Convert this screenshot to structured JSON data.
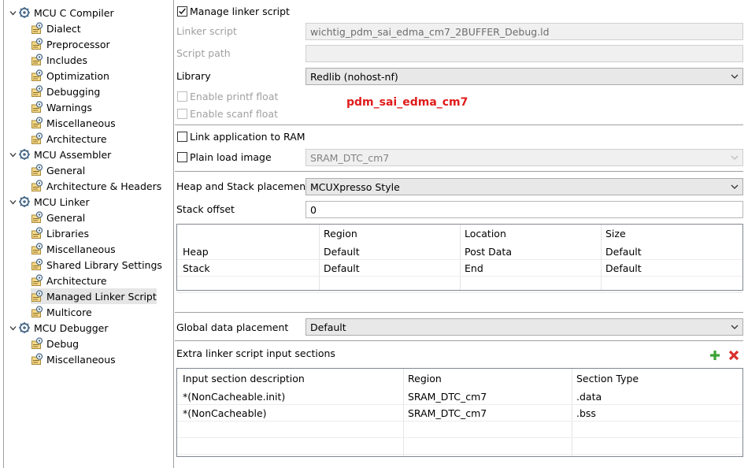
{
  "tree": [
    {
      "label": "MCU C Compiler",
      "level": 0,
      "icon": "settings-gear-icon"
    },
    {
      "label": "Dialect",
      "level": 1,
      "icon": "settings-page-icon"
    },
    {
      "label": "Preprocessor",
      "level": 1,
      "icon": "settings-page-icon"
    },
    {
      "label": "Includes",
      "level": 1,
      "icon": "settings-page-icon"
    },
    {
      "label": "Optimization",
      "level": 1,
      "icon": "settings-page-icon"
    },
    {
      "label": "Debugging",
      "level": 1,
      "icon": "settings-page-icon"
    },
    {
      "label": "Warnings",
      "level": 1,
      "icon": "settings-page-icon"
    },
    {
      "label": "Miscellaneous",
      "level": 1,
      "icon": "settings-page-icon"
    },
    {
      "label": "Architecture",
      "level": 1,
      "icon": "settings-page-icon"
    },
    {
      "label": "MCU Assembler",
      "level": 0,
      "icon": "settings-gear-icon"
    },
    {
      "label": "General",
      "level": 1,
      "icon": "settings-page-icon"
    },
    {
      "label": "Architecture & Headers",
      "level": 1,
      "icon": "settings-page-icon"
    },
    {
      "label": "MCU Linker",
      "level": 0,
      "icon": "settings-gear-icon"
    },
    {
      "label": "General",
      "level": 1,
      "icon": "settings-page-icon"
    },
    {
      "label": "Libraries",
      "level": 1,
      "icon": "settings-page-icon"
    },
    {
      "label": "Miscellaneous",
      "level": 1,
      "icon": "settings-page-icon"
    },
    {
      "label": "Shared Library Settings",
      "level": 1,
      "icon": "settings-page-icon"
    },
    {
      "label": "Architecture",
      "level": 1,
      "icon": "settings-page-icon"
    },
    {
      "label": "Managed Linker Script",
      "level": 1,
      "icon": "settings-page-icon",
      "selected": true
    },
    {
      "label": "Multicore",
      "level": 1,
      "icon": "settings-page-icon"
    },
    {
      "label": "MCU Debugger",
      "level": 0,
      "icon": "settings-gear-icon"
    },
    {
      "label": "Debug",
      "level": 1,
      "icon": "settings-page-icon"
    },
    {
      "label": "Miscellaneous",
      "level": 1,
      "icon": "settings-page-icon"
    }
  ],
  "form": {
    "manage_linker_script": {
      "label": "Manage linker script",
      "checked": true
    },
    "linker_script": {
      "label": "Linker script",
      "value": "wichtig_pdm_sai_edma_cm7_2BUFFER_Debug.ld"
    },
    "script_path": {
      "label": "Script path",
      "value": ""
    },
    "library": {
      "label": "Library",
      "value": "Redlib (nohost-nf)"
    },
    "enable_printf_float": {
      "label": "Enable printf float",
      "checked": false
    },
    "enable_scanf_float": {
      "label": "Enable scanf float",
      "checked": false
    },
    "project_annotation": "pdm_sai_edma_cm7",
    "link_app_to_ram": {
      "label": "Link application to RAM",
      "checked": false
    },
    "plain_load_image": {
      "label": "Plain load image",
      "checked": false,
      "value": "SRAM_DTC_cm7"
    },
    "heap_stack_placement": {
      "label": "Heap and Stack placement",
      "value": "MCUXpresso Style"
    },
    "stack_offset": {
      "label": "Stack offset",
      "value": "0"
    },
    "global_data_placement": {
      "label": "Global data placement",
      "value": "Default"
    },
    "extra_sections_label": "Extra linker script input sections"
  },
  "heap_table": {
    "columns": [
      "",
      "Region",
      "Location",
      "Size"
    ],
    "rows": [
      [
        "Heap",
        "Default",
        "Post Data",
        "Default"
      ],
      [
        "Stack",
        "Default",
        "End",
        "Default"
      ]
    ]
  },
  "sections_table": {
    "columns": [
      "Input section description",
      "Region",
      "Section Type"
    ],
    "rows": [
      [
        "*(NonCacheable.init)",
        "SRAM_DTC_cm7",
        ".data"
      ],
      [
        "*(NonCacheable)",
        "SRAM_DTC_cm7",
        ".bss"
      ]
    ]
  },
  "colors": {
    "annotation": "#e01b1b",
    "add_icon": "#3aa335",
    "remove_icon": "#d9302c"
  }
}
